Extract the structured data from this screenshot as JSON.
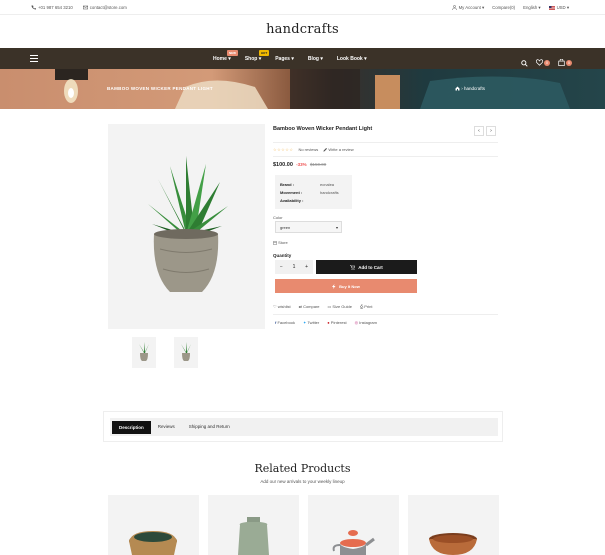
{
  "topbar": {
    "phone": "+01 987 654 3210",
    "email": "contact@store.com",
    "account": "My Account",
    "compare": "Compare(0)",
    "language": "English",
    "currency": "USD"
  },
  "logo": "handcrafts",
  "nav": {
    "items": [
      {
        "label": "Home",
        "badge": "NEW"
      },
      {
        "label": "Shop",
        "badge": "HOT"
      },
      {
        "label": "Pages",
        "badge": ""
      },
      {
        "label": "Blog",
        "badge": ""
      },
      {
        "label": "Look Book",
        "badge": ""
      }
    ],
    "wishlist_count": "0",
    "cart_count": "0"
  },
  "banner": {
    "title": "BAMBOO WOVEN WICKER PENDANT LIGHT",
    "breadcrumb": "handcrafts"
  },
  "product": {
    "title": "Bamboo Woven Wicker Pendant Light",
    "reviews": "No reviews",
    "write_review": "Write a review",
    "price": "$100.00",
    "discount": "-33%",
    "old_price": "$150.00",
    "specs": [
      {
        "key": "Brand :",
        "value": "ecnalea"
      },
      {
        "key": "Movement :",
        "value": "handcrafts"
      },
      {
        "key": "Availability :",
        "value": ""
      }
    ],
    "color_label": "Color",
    "color_value": "green",
    "store": "Store",
    "quantity_label": "Quantity",
    "quantity": "1",
    "add_to_cart": "Add to Cart",
    "buy_now": "Buy It Now",
    "links": [
      "wishlist",
      "Compare",
      "Size Guide",
      "Print"
    ],
    "social": [
      "Facebook",
      "Twitter",
      "Pinterest",
      "Instagram"
    ]
  },
  "tabs": [
    "Description",
    "Reviews",
    "Shipping and Return"
  ],
  "related": {
    "title": "Related Products",
    "subtitle": "Add our new arrivals to your weekly lineup"
  },
  "colors": {
    "nav_bg": "#3b3228",
    "accent": "#e88a6f",
    "button_dark": "#1b1b1b"
  }
}
